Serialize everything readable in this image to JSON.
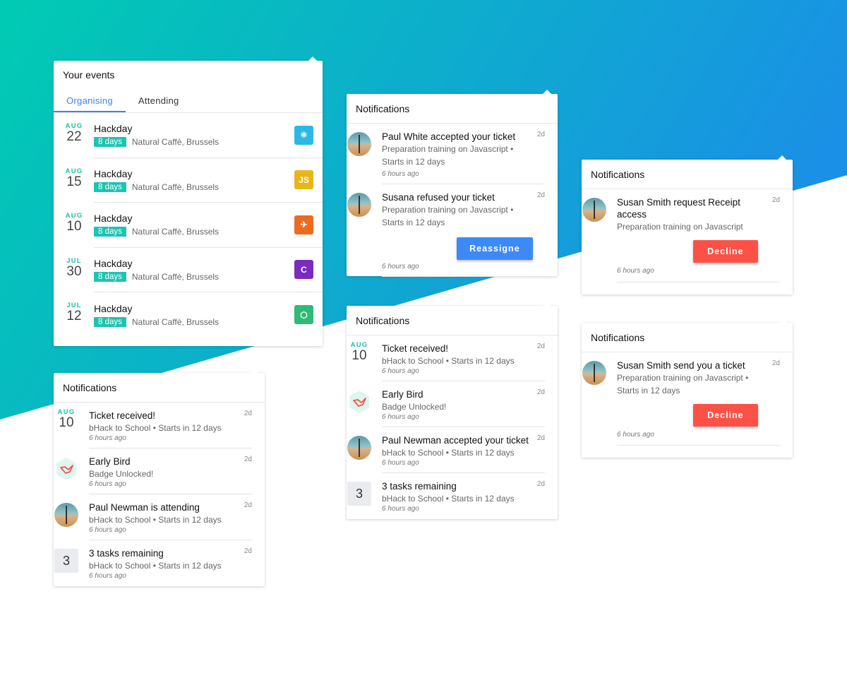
{
  "colors": {
    "gradient_start": "#00cbb2",
    "gradient_end": "#1a90e6",
    "accent_teal": "#1ec3b2",
    "tab_active": "#3b82f6",
    "button_blue": "#3d8af6",
    "button_red": "#fb5147"
  },
  "events_card": {
    "title": "Your events",
    "tabs": [
      {
        "label": "Organising",
        "active": true
      },
      {
        "label": "Attending",
        "active": false
      }
    ],
    "items": [
      {
        "month": "AUG",
        "day": "22",
        "title": "Hackday",
        "badge": "8 days",
        "location": "Natural Caffè, Brussels",
        "icon": "react-icon",
        "icon_color": "#2cb8e6",
        "icon_text": "⚛"
      },
      {
        "month": "AUG",
        "day": "15",
        "title": "Hackday",
        "badge": "8 days",
        "location": "Natural Caffè, Brussels",
        "icon": "javascript-icon",
        "icon_color": "#e8b61a",
        "icon_text": "JS"
      },
      {
        "month": "AUG",
        "day": "10",
        "title": "Hackday",
        "badge": "8 days",
        "location": "Natural Caffè, Brussels",
        "icon": "swift-icon",
        "icon_color": "#ee6a20",
        "icon_text": "✈"
      },
      {
        "month": "JUL",
        "day": "30",
        "title": "Hackday",
        "badge": "8 days",
        "location": "Natural Caffè, Brussels",
        "icon": "c-sharp-icon",
        "icon_color": "#7b2bbf",
        "icon_text": "C"
      },
      {
        "month": "JUL",
        "day": "12",
        "title": "Hackday",
        "badge": "8 days",
        "location": "Natural Caffè, Brussels",
        "icon": "nodejs-icon",
        "icon_color": "#2fba76",
        "icon_text": "⬡"
      }
    ]
  },
  "notif_a": {
    "title": "Notifications",
    "items": [
      {
        "lead": "date",
        "month": "AUG",
        "day": "10",
        "title": "Ticket received!",
        "sub": "bHack to School • Starts in 12 days",
        "time": "6 hours ago",
        "age": "2d"
      },
      {
        "lead": "badge",
        "icon": "bird-badge-icon",
        "title": "Early Bird",
        "sub": "Badge Unlocked!",
        "time": "6 hours ago",
        "age": "2d"
      },
      {
        "lead": "avatar",
        "title": "Paul Newman is attending",
        "sub": "bHack to School • Starts in 12 days",
        "time": "6 hours ago",
        "age": "2d"
      },
      {
        "lead": "count",
        "count": "3",
        "title": "3 tasks remaining",
        "sub": "bHack to School • Starts in 12 days",
        "time": "6 hours ago",
        "age": "2d"
      }
    ]
  },
  "notif_b": {
    "title": "Notifications",
    "items": [
      {
        "title": "Paul White accepted your ticket",
        "sub": "Preparation training on Javascript • Starts in 12 days",
        "time": "6 hours ago",
        "age": "2d"
      },
      {
        "title": "Susana refused your ticket",
        "sub": "Preparation training on Javascript • Starts in 12 days",
        "time": "6 hours ago",
        "age": "2d",
        "button": "Reassigne"
      }
    ]
  },
  "notif_c": {
    "title": "Notifications",
    "items": [
      {
        "lead": "date",
        "month": "AUG",
        "day": "10",
        "title": "Ticket received!",
        "sub": "bHack to School • Starts in 12 days",
        "time": "6 hours ago",
        "age": "2d"
      },
      {
        "lead": "badge",
        "title": "Early Bird",
        "sub": "Badge Unlocked!",
        "time": "6 hours ago",
        "age": "2d"
      },
      {
        "lead": "avatar",
        "title": "Paul Newman accepted your ticket",
        "sub": "bHack to School • Starts in 12 days",
        "time": "6 hours ago",
        "age": "2d"
      },
      {
        "lead": "count",
        "count": "3",
        "title": "3 tasks remaining",
        "sub": "bHack to School • Starts in 12 days",
        "time": "6 hours ago",
        "age": "2d"
      }
    ]
  },
  "notif_d": {
    "title": "Notifications",
    "item": {
      "title": "Susan Smith request Receipt access",
      "sub": "Preparation training on Javascript",
      "time": "6 hours ago",
      "age": "2d",
      "button": "Decline"
    }
  },
  "notif_e": {
    "title": "Notifications",
    "item": {
      "title": "Susan Smith send you a ticket",
      "sub": "Preparation training on Javascript • Starts in 12 days",
      "time": "6 hours ago",
      "age": "2d",
      "button": "Decline"
    }
  }
}
